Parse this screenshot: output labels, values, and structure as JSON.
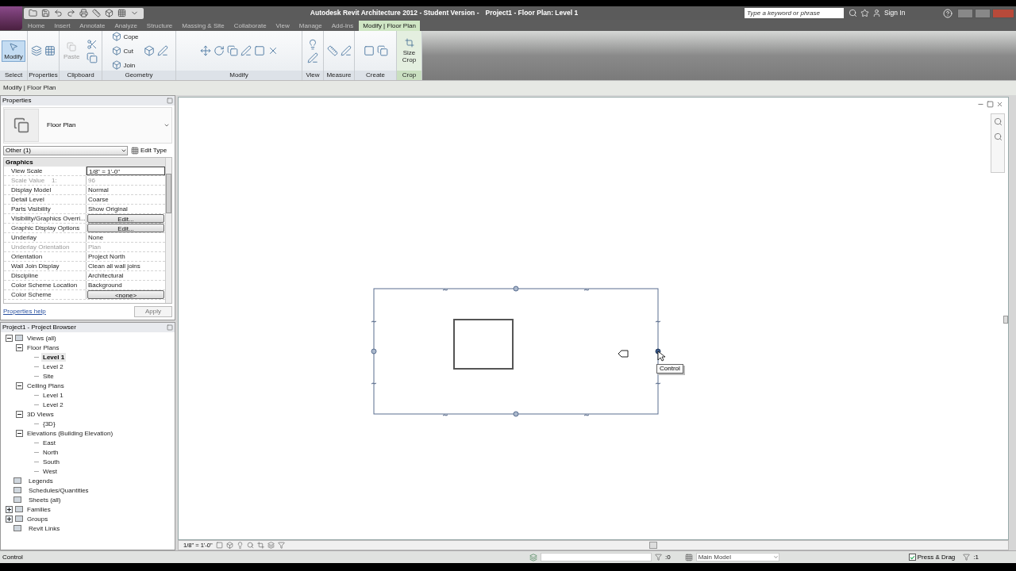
{
  "window": {
    "title": "Autodesk Revit Architecture 2012 - Student Version -",
    "document": "Project1 - Floor Plan: Level 1"
  },
  "search": {
    "placeholder": "Type a keyword or phrase"
  },
  "sign_in": "Sign In",
  "tabs": [
    {
      "label": "Home",
      "selected": false
    },
    {
      "label": "Insert",
      "selected": false
    },
    {
      "label": "Annotate",
      "selected": false
    },
    {
      "label": "Analyze",
      "selected": false
    },
    {
      "label": "Structure",
      "selected": false
    },
    {
      "label": "Massing & Site",
      "selected": false
    },
    {
      "label": "Collaborate",
      "selected": false
    },
    {
      "label": "View",
      "selected": false
    },
    {
      "label": "Manage",
      "selected": false
    },
    {
      "label": "Add-Ins",
      "selected": false
    },
    {
      "label": "Modify | Floor Plan",
      "selected": true
    }
  ],
  "ribbon": {
    "panels": [
      {
        "label": "Select",
        "buttons": [
          {
            "label": "Modify",
            "active": true,
            "disabled": false
          }
        ]
      },
      {
        "label": "Properties"
      },
      {
        "label": "Clipboard",
        "buttons": [
          {
            "label": "Paste",
            "active": false,
            "disabled": true
          }
        ]
      },
      {
        "label": "Geometry",
        "buttons": [
          {
            "label": "Cope",
            "active": false,
            "disabled": false
          },
          {
            "label": "Cut",
            "active": false,
            "disabled": false
          },
          {
            "label": "Join",
            "active": false,
            "disabled": false
          }
        ]
      },
      {
        "label": "Modify"
      },
      {
        "label": "View"
      },
      {
        "label": "Measure"
      },
      {
        "label": "Create"
      },
      {
        "label": "Crop",
        "buttons": [
          {
            "label": "Size Crop",
            "active": false,
            "disabled": false
          }
        ]
      }
    ]
  },
  "context_bar": "Modify | Floor Plan",
  "properties": {
    "title": "Properties",
    "type_name": "Floor Plan",
    "selector": "Other (1)",
    "edit_type": "Edit Type",
    "group": "Graphics",
    "rows": [
      {
        "name": "View Scale",
        "value": "1/8\" = 1'-0\"",
        "kind": "field",
        "disabled": false
      },
      {
        "name": "Scale Value    1:",
        "value": "96",
        "kind": "text",
        "disabled": true
      },
      {
        "name": "Display Model",
        "value": "Normal",
        "kind": "text",
        "disabled": false
      },
      {
        "name": "Detail Level",
        "value": "Coarse",
        "kind": "text",
        "disabled": false
      },
      {
        "name": "Parts Visibility",
        "value": "Show Original",
        "kind": "text",
        "disabled": false
      },
      {
        "name": "Visibility/Graphics Overri...",
        "value": "Edit...",
        "kind": "button",
        "disabled": false
      },
      {
        "name": "Graphic Display Options",
        "value": "Edit...",
        "kind": "button",
        "disabled": false
      },
      {
        "name": "Underlay",
        "value": "None",
        "kind": "text",
        "disabled": false
      },
      {
        "name": "Underlay Orientation",
        "value": "Plan",
        "kind": "text",
        "disabled": true
      },
      {
        "name": "Orientation",
        "value": "Project North",
        "kind": "text",
        "disabled": false
      },
      {
        "name": "Wall Join Display",
        "value": "Clean all wall joins",
        "kind": "text",
        "disabled": false
      },
      {
        "name": "Discipline",
        "value": "Architectural",
        "kind": "text",
        "disabled": false
      },
      {
        "name": "Color Scheme Location",
        "value": "Background",
        "kind": "text",
        "disabled": false
      },
      {
        "name": "Color Scheme",
        "value": "<none>",
        "kind": "button",
        "disabled": false
      }
    ],
    "help": "Properties help",
    "apply": "Apply"
  },
  "browser": {
    "title": "Project1 - Project Browser",
    "tree": [
      {
        "label": "Views (all)",
        "expanded": true,
        "selected": false,
        "children": [
          {
            "label": "Floor Plans",
            "expanded": true,
            "selected": false,
            "children": [
              {
                "label": "Level 1",
                "selected": true
              },
              {
                "label": "Level 2",
                "selected": false
              },
              {
                "label": "Site",
                "selected": false
              }
            ]
          },
          {
            "label": "Ceiling Plans",
            "expanded": true,
            "selected": false,
            "children": [
              {
                "label": "Level 1",
                "selected": false
              },
              {
                "label": "Level 2",
                "selected": false
              }
            ]
          },
          {
            "label": "3D Views",
            "expanded": true,
            "selected": false,
            "children": [
              {
                "label": "{3D}",
                "selected": false
              }
            ]
          },
          {
            "label": "Elevations (Building Elevation)",
            "expanded": true,
            "selected": false,
            "children": [
              {
                "label": "East",
                "selected": false
              },
              {
                "label": "North",
                "selected": false
              },
              {
                "label": "South",
                "selected": false
              },
              {
                "label": "West",
                "selected": false
              }
            ]
          }
        ]
      },
      {
        "label": "Legends",
        "selected": false
      },
      {
        "label": "Schedules/Quantities",
        "selected": false
      },
      {
        "label": "Sheets (all)",
        "selected": false
      },
      {
        "label": "Families",
        "expanded": false,
        "selected": false
      },
      {
        "label": "Groups",
        "expanded": false,
        "selected": false
      },
      {
        "label": "Revit Links",
        "selected": false
      }
    ]
  },
  "canvas": {
    "tooltip": "Control"
  },
  "view_bar": {
    "scale": "1/8\" = 1'-0\""
  },
  "status": {
    "prompt": "Control",
    "count": ":0",
    "model": "Main Model",
    "press_drag": {
      "label": "Press & Drag",
      "checked": true
    },
    "filter": ":1"
  }
}
